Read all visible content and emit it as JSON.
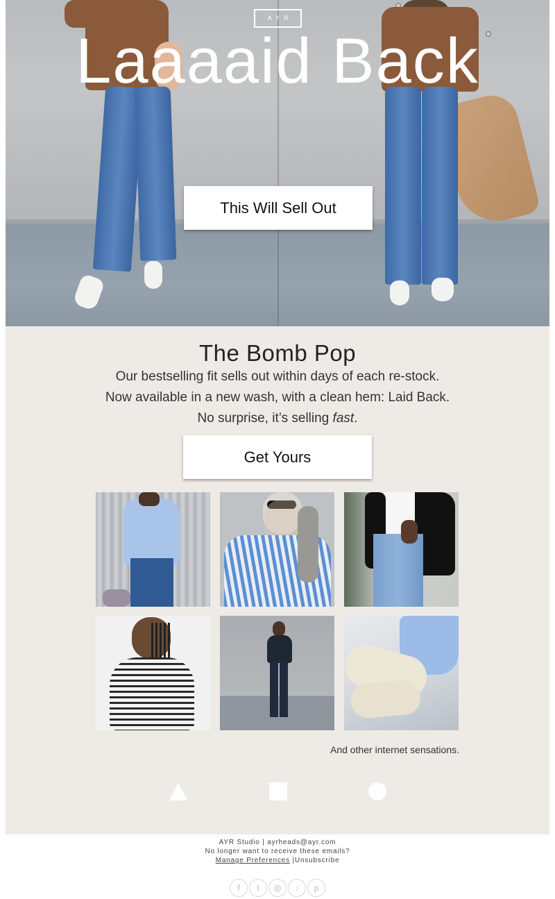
{
  "hero": {
    "logo": "AYR",
    "title": "Laaaaid Back",
    "cta_label": "This Will Sell Out"
  },
  "product": {
    "title": "The Bomb Pop",
    "line1": "Our bestselling fit sells out within days of each re-stock.",
    "line2": "Now available in a new wash, with a clean hem: Laid Back.",
    "line3_prefix": "No surprise, it’s selling ",
    "line3_emphasis": "fast",
    "line3_suffix": ".",
    "cta_label": "Get Yours"
  },
  "gallery": {
    "photos": [
      {
        "icon": "photo-blue-shirt-jeans"
      },
      {
        "icon": "photo-striped-shirt-sunglasses"
      },
      {
        "icon": "photo-black-blazer-jeans"
      },
      {
        "icon": "photo-striped-top-smiling"
      },
      {
        "icon": "photo-black-outfit-full-length"
      },
      {
        "icon": "photo-blue-shirt-white-jeans"
      }
    ],
    "tagline": "And other internet sensations."
  },
  "shapes": [
    "triangle-icon",
    "square-icon",
    "circle-icon"
  ],
  "footer": {
    "studio": "AYR Studio",
    "separator": "|",
    "email": "ayrheads@ayr.com",
    "unsubscribe_question": "No longer want to receive these emails?",
    "manage_preferences": "Manage Preferences",
    "unsubscribe": "Unsubscribe",
    "socials": [
      {
        "icon": "facebook-icon",
        "glyph": "f"
      },
      {
        "icon": "tumblr-icon",
        "glyph": "t"
      },
      {
        "icon": "instagram-icon",
        "glyph": "◎"
      },
      {
        "icon": "twitter-icon",
        "glyph": "♪"
      },
      {
        "icon": "pinterest-icon",
        "glyph": "p"
      }
    ]
  },
  "colors": {
    "content_bg": "#eeebe7",
    "button_bg": "#ffffff",
    "text": "#222222"
  }
}
